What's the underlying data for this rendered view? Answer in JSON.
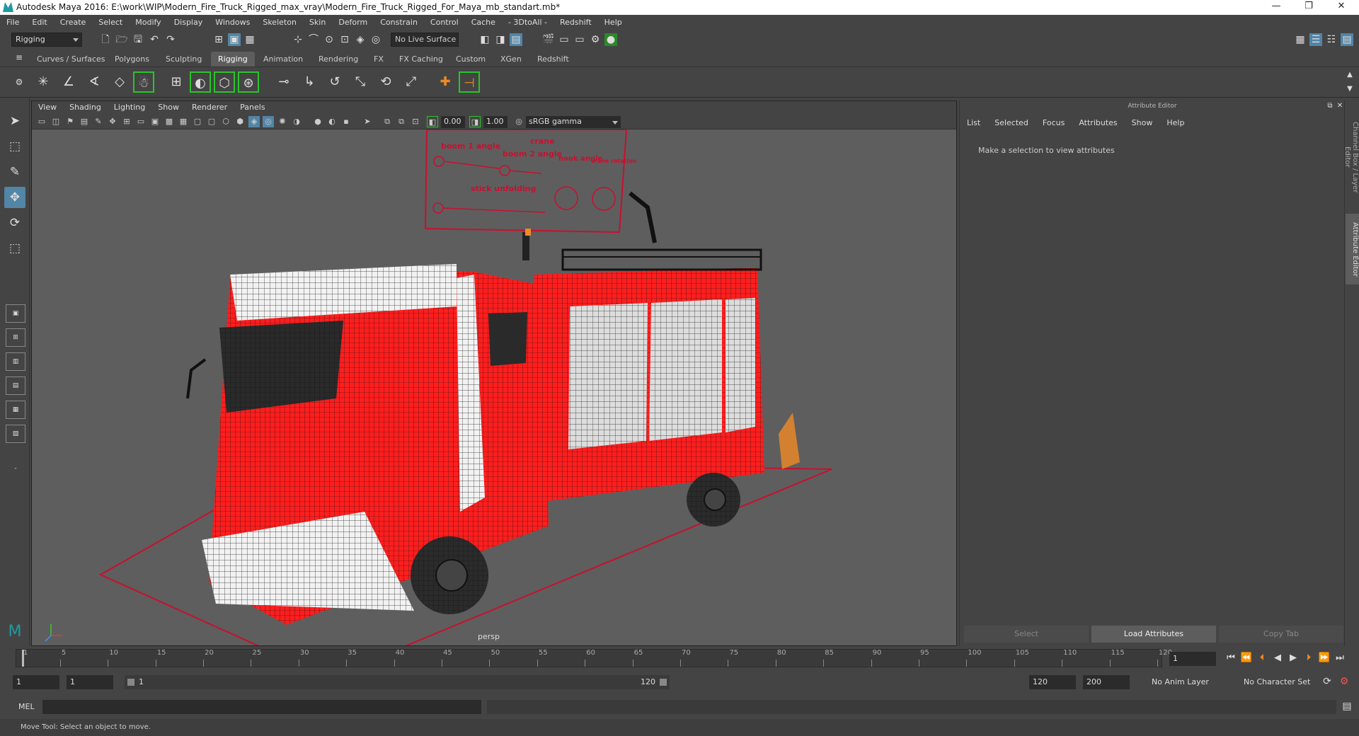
{
  "window": {
    "title": "Autodesk Maya 2016: E:\\work\\WIP\\Modern_Fire_Truck_Rigged_max_vray\\Modern_Fire_Truck_Rigged_For_Maya_mb_standart.mb*",
    "min": "—",
    "max": "❐",
    "close": "✕"
  },
  "menu": [
    "File",
    "Edit",
    "Create",
    "Select",
    "Modify",
    "Display",
    "Windows",
    "Skeleton",
    "Skin",
    "Deform",
    "Constrain",
    "Control",
    "Cache",
    "- 3DtoAll -",
    "Redshift",
    "Help"
  ],
  "status": {
    "mode": "Rigging",
    "live_surface": "No Live Surface"
  },
  "shelf_tabs": [
    "Curves / Surfaces",
    "Polygons",
    "Sculpting",
    "Rigging",
    "Animation",
    "Rendering",
    "FX",
    "FX Caching",
    "Custom",
    "XGen",
    "Redshift"
  ],
  "active_shelf": "Rigging",
  "viewport": {
    "menu": [
      "View",
      "Shading",
      "Lighting",
      "Show",
      "Renderer",
      "Panels"
    ],
    "exposure": "0.00",
    "gamma": "1.00",
    "color_space": "sRGB gamma",
    "camera": "persp"
  },
  "rig_panel": {
    "title": "crane",
    "labels": [
      "boom 1 angle",
      "boom 2 angle",
      "hook angle",
      "crane rotation",
      "stick unfolding"
    ]
  },
  "attr_editor": {
    "header": "Attribute Editor",
    "menu": [
      "List",
      "Selected",
      "Focus",
      "Attributes",
      "Show",
      "Help"
    ],
    "message": "Make a selection to view attributes",
    "buttons": [
      "Select",
      "Load Attributes",
      "Copy Tab"
    ]
  },
  "side_tabs": [
    "Channel Box / Layer Editor",
    "Attribute Editor"
  ],
  "timeline": {
    "ticks": [
      "1",
      "5",
      "10",
      "15",
      "20",
      "25",
      "30",
      "35",
      "40",
      "45",
      "50",
      "55",
      "60",
      "65",
      "70",
      "75",
      "80",
      "85",
      "90",
      "95",
      "100",
      "105",
      "110",
      "115",
      "120"
    ],
    "current": "1"
  },
  "range": {
    "start": "1",
    "inner_start": "1",
    "slider_start": "1",
    "slider_end": "120",
    "end": "120",
    "max": "200",
    "anim_layer": "No Anim Layer",
    "char_set": "No Character Set"
  },
  "command": {
    "lang": "MEL"
  },
  "help": "Move Tool: Select an object to move.",
  "colors": {
    "accent": "#5285a6",
    "truck_red": "#ff1e1e",
    "rig_red": "#c8102e"
  }
}
